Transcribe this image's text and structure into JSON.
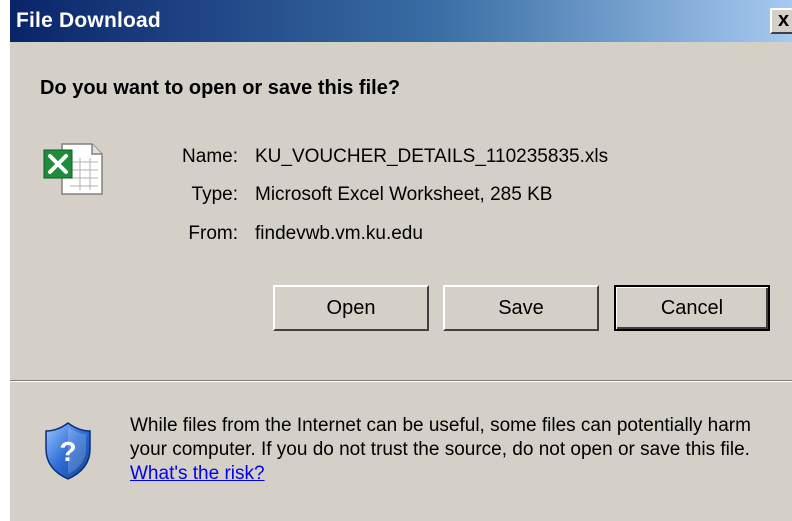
{
  "window": {
    "title": "File Download",
    "close_label": "x"
  },
  "prompt": {
    "question": "Do you want to open or save this file?"
  },
  "file": {
    "icon": "excel-file-icon",
    "name_label": "Name:",
    "name_value": "KU_VOUCHER_DETAILS_110235835.xls",
    "type_label": "Type:",
    "type_value": "Microsoft Excel Worksheet, 285 KB",
    "from_label": "From:",
    "from_value": "findevwb.vm.ku.edu"
  },
  "buttons": {
    "open": "Open",
    "save": "Save",
    "cancel": "Cancel"
  },
  "warning": {
    "icon": "security-shield-icon",
    "text": "While files from the Internet can be useful, some files can potentially harm your computer. If you do not trust the source, do not open or save this file. ",
    "link": "What's the risk?"
  },
  "colors": {
    "dialog_bg": "#d4d0c8",
    "title_start": "#0a246a",
    "title_end": "#a6caf0",
    "link": "#0000ee"
  }
}
